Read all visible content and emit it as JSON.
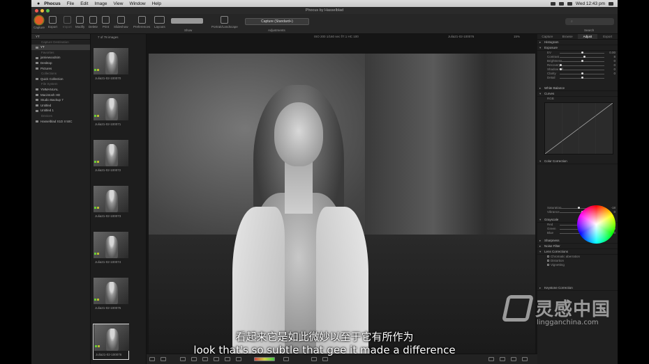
{
  "menubar": {
    "app": "Phocus",
    "menus": [
      "File",
      "Edit",
      "Image",
      "View",
      "Window",
      "Help"
    ],
    "clock": "Wed 12:43 pm"
  },
  "window": {
    "title": "Phocus by Hasselblad"
  },
  "toolbar": {
    "buttons": [
      "Capture",
      "Export",
      "Import",
      "Modify",
      "Delete",
      "Print",
      "Slideshow",
      "Preferences",
      "Layouts"
    ],
    "show_label": "Show",
    "portrait_label": "Portrait/Landscape",
    "adjustments_value": "Capture (Standard+)",
    "adjustments_label": "Adjustments",
    "search_label": "Search"
  },
  "left_panel": {
    "path": "YT",
    "rows": [
      {
        "label": "Capture Destination",
        "type": "head"
      },
      {
        "label": "YT",
        "type": "sel"
      },
      {
        "label": "Favorites",
        "type": "head"
      },
      {
        "label": "jamiewoodsim",
        "type": "item"
      },
      {
        "label": "Desktop",
        "type": "item"
      },
      {
        "label": "Pictures",
        "type": "item"
      },
      {
        "label": "Collections",
        "type": "head"
      },
      {
        "label": "Quick Collection",
        "type": "item"
      },
      {
        "label": "File System",
        "type": "head"
      },
      {
        "label": "YMMANUAL",
        "type": "item"
      },
      {
        "label": "Macintosh HD",
        "type": "item"
      },
      {
        "label": "Studio Backup 7",
        "type": "item"
      },
      {
        "label": "Untitled",
        "type": "item"
      },
      {
        "label": "Untitled 1",
        "type": "item"
      },
      {
        "label": "Devices",
        "type": "head"
      },
      {
        "label": "Hasselblad X1D II 50C",
        "type": "item"
      }
    ]
  },
  "browser": {
    "count": "7 of 78 images",
    "thumbs": [
      "Julia21-02-100070",
      "Julia21-02-100071",
      "Julia21-02-100072",
      "Julia21-02-100073",
      "Julia21-02-100074",
      "Julia21-02-100075",
      "Julia21-02-100076"
    ]
  },
  "viewer": {
    "exif": "ISO 200   1/160 sec   f/7.1   HC 100",
    "filename": "Julia21-02-100076",
    "zoom": "15%"
  },
  "right_panel": {
    "tabs": [
      "Capture",
      "Browse",
      "Adjust",
      "Export"
    ],
    "active_tab": "Adjust",
    "sections": {
      "histogram": "Histogram",
      "exposure": "Exposure",
      "white_balance": "White Balance",
      "curves": "Curves",
      "color_correction": "Color Correction",
      "grayscale": "Grayscale",
      "sharpness": "Sharpness",
      "noise_filter": "Noise Filter",
      "lens_corrections": "Lens Corrections",
      "keystone": "Keystone Correction"
    },
    "exposure_rows": [
      {
        "label": "EV",
        "value": "0.00",
        "pos": 0.5
      },
      {
        "label": "Contrast",
        "value": "8",
        "pos": 0.55
      },
      {
        "label": "Brightness",
        "value": "0",
        "pos": 0.5
      },
      {
        "label": "Recovery",
        "value": "0",
        "pos": 0.0
      },
      {
        "label": "Shadow Fill",
        "value": "0",
        "pos": 0.0
      },
      {
        "label": "Clarity",
        "value": "0",
        "pos": 0.5
      },
      {
        "label": "Detail",
        "value": "",
        "pos": 0.5
      }
    ],
    "curves_preset": "RGB",
    "color_rows": [
      {
        "label": "Saturation",
        "value": "-18",
        "pos": 0.42
      },
      {
        "label": "Vibrance",
        "value": "0",
        "pos": 0.5
      }
    ],
    "grayscale_rows": [
      {
        "label": "Red",
        "value": "0",
        "pos": 0.5
      },
      {
        "label": "Green",
        "value": "100",
        "pos": 1.0
      },
      {
        "label": "Blue",
        "value": "0",
        "pos": 0.5
      }
    ],
    "lens_rows": [
      "Chromatic aberration",
      "Distortion",
      "Vignetting"
    ]
  },
  "subtitles": {
    "zh": "看起来它是如此微妙以至于它有所作为",
    "en": "look that's so subtle that gee it made a difference"
  },
  "watermark": {
    "title": "灵感中国",
    "url": "lingganchina.com"
  }
}
